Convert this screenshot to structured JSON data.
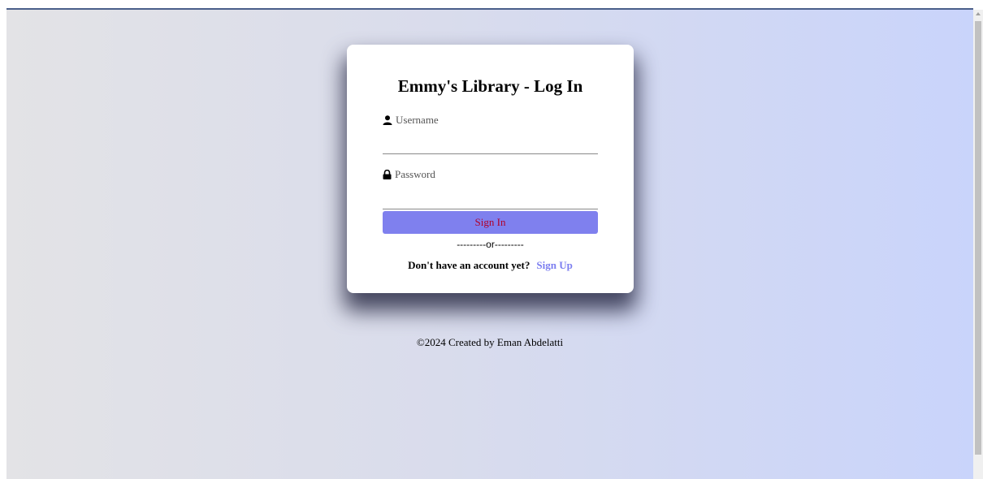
{
  "login": {
    "title": "Emmy's Library - Log In",
    "username_placeholder": "Username",
    "password_placeholder": "Password",
    "signin_label": "Sign In",
    "divider": "---------or---------",
    "signup_prompt": "Don't have an account yet?",
    "signup_link": "Sign Up"
  },
  "footer": {
    "text": "©2024 Created by Eman Abdelatti"
  },
  "icons": {
    "username": "user-icon",
    "password": "lock-icon"
  },
  "colors": {
    "button": "#7f80ee",
    "button_text": "#b0002a",
    "link": "#7c7ef0"
  }
}
